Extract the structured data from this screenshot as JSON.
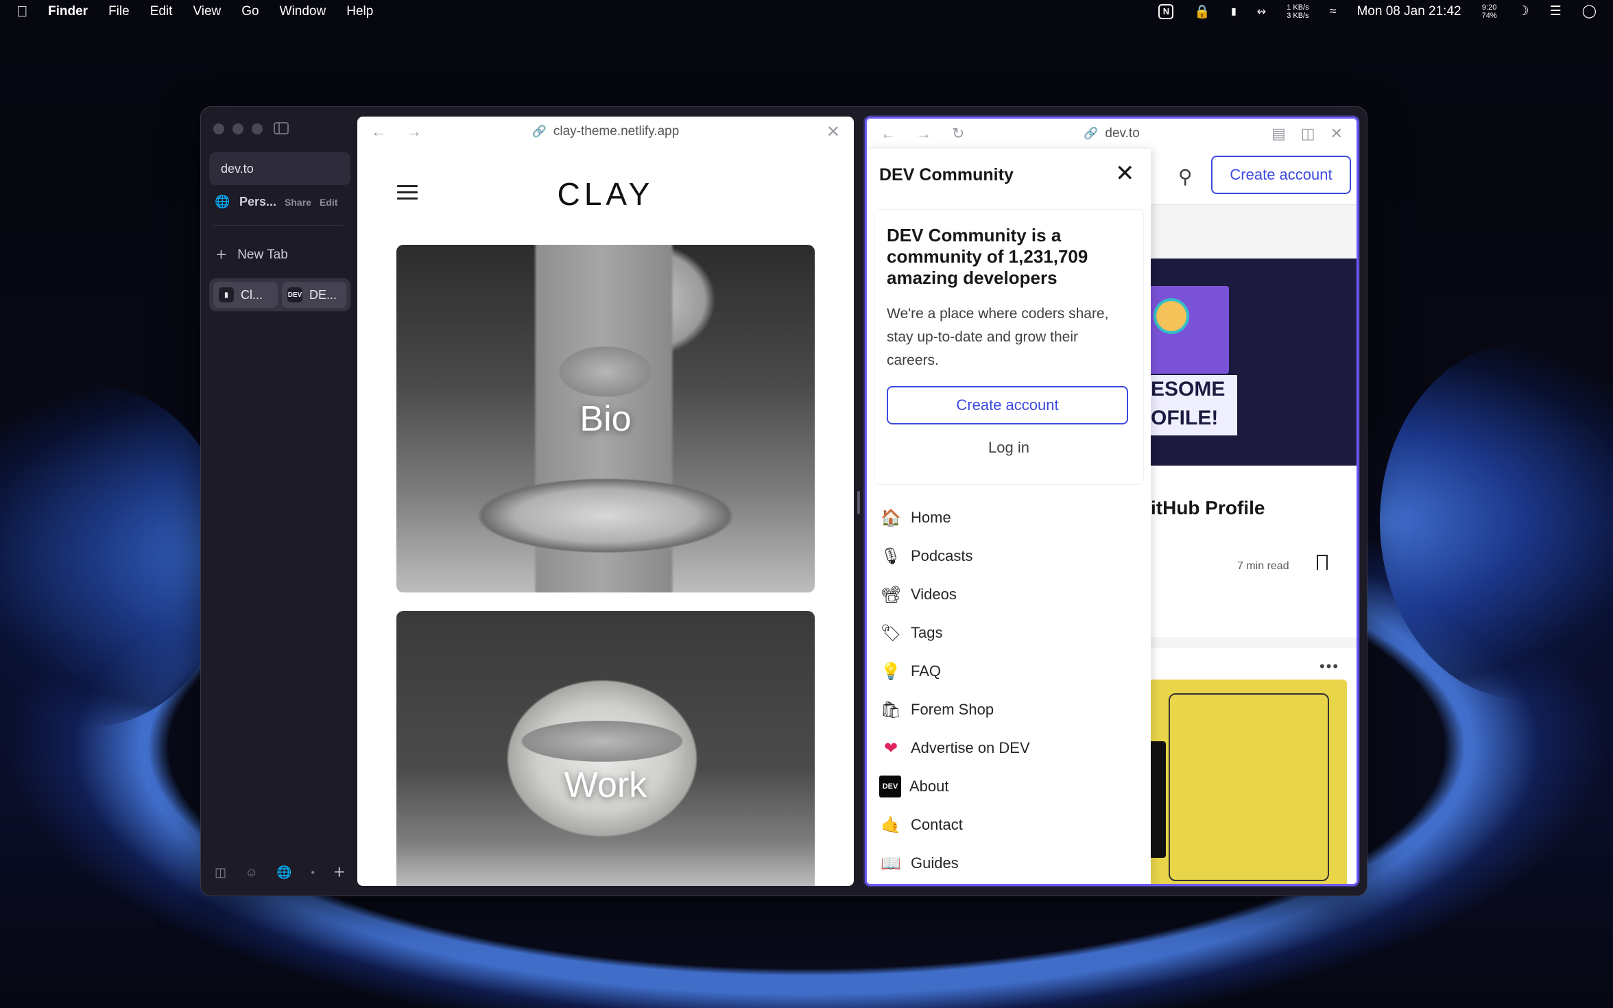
{
  "menubar": {
    "app": "Finder",
    "items": [
      "File",
      "Edit",
      "View",
      "Go",
      "Window",
      "Help"
    ],
    "net_up": "1 KB/s",
    "net_down": "3 KB/s",
    "battery_time": "9:20",
    "battery_pct": "74%",
    "clock": "Mon 08 Jan 21:42"
  },
  "sidebar": {
    "url": "dev.to",
    "space_name": "Pers...",
    "space_share": "Share",
    "space_edit": "Edit",
    "new_tab": "New Tab",
    "tabs": [
      {
        "label": "Cl...",
        "favicon": "clay-favicon"
      },
      {
        "label": "DE...",
        "favicon": "DEV"
      }
    ]
  },
  "left_pane": {
    "url": "clay-theme.netlify.app",
    "logo": "CLAY",
    "cards": [
      {
        "label": "Bio"
      },
      {
        "label": "Work"
      }
    ]
  },
  "right_pane": {
    "url": "dev.to",
    "header_create": "Create account",
    "banner_text_1": "ESOME",
    "banner_text_2": "OFILE!",
    "article_title": "itHub Profile",
    "read_time": "7 min read",
    "drawer": {
      "title": "DEV Community",
      "promo_heading": "DEV Community is a community of 1,231,709 amazing developers",
      "promo_text": "We're a place where coders share, stay up-to-date and grow their careers.",
      "create_account": "Create account",
      "log_in": "Log in",
      "nav": [
        {
          "label": "Home",
          "icon": "🏠"
        },
        {
          "label": "Podcasts",
          "icon": "🎙"
        },
        {
          "label": "Videos",
          "icon": "📽"
        },
        {
          "label": "Tags",
          "icon": "🏷"
        },
        {
          "label": "FAQ",
          "icon": "💡"
        },
        {
          "label": "Forem Shop",
          "icon": "🛍"
        },
        {
          "label": "Advertise on DEV",
          "icon": "❤"
        },
        {
          "label": "About",
          "icon": "DEV"
        },
        {
          "label": "Contact",
          "icon": "🤙"
        },
        {
          "label": "Guides",
          "icon": "📖"
        }
      ]
    }
  },
  "colors": {
    "dev_accent": "#3b49df",
    "pane_focus": "#6d5cff"
  }
}
